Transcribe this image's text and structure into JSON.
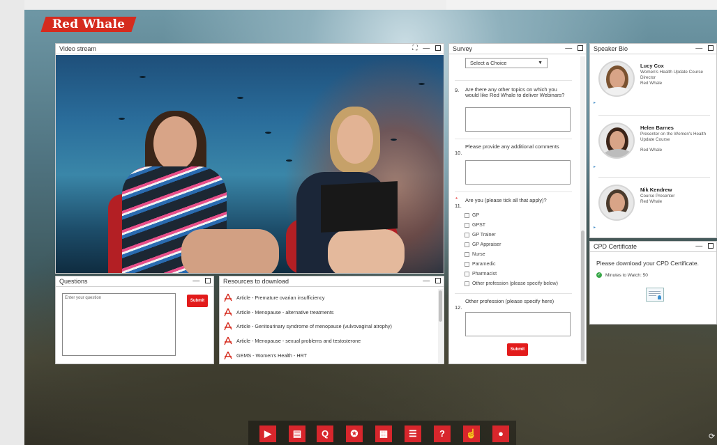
{
  "brand": {
    "logo_text": "Red Whale"
  },
  "video": {
    "title": "Video stream",
    "ctrl_expand": "⛶",
    "ctrl_min": "—"
  },
  "questions": {
    "title": "Questions",
    "ctrl_min": "—",
    "placeholder": "Enter your question",
    "submit_label": "Submit"
  },
  "resources": {
    "title": "Resources to download",
    "ctrl_min": "—",
    "items": [
      {
        "label": "Article - Premature ovarian insufficiency"
      },
      {
        "label": "Article - Menopause - alternative treatments"
      },
      {
        "label": "Article - Genitourinary syndrome of menopause (vulvovaginal atrophy)"
      },
      {
        "label": "Article - Menopause - sexual problems and testosterone"
      },
      {
        "label": "GEMS - Women's Health - HRT"
      }
    ]
  },
  "survey": {
    "title": "Survey",
    "ctrl_min": "—",
    "select_value": "Select a Choice",
    "select_arrow": "▼",
    "q9": {
      "num": "9.",
      "text": "Are there any other topics on which you would like Red Whale to deliver Webinars?"
    },
    "q10": {
      "num": "10.",
      "text": "Please provide any additional comments"
    },
    "q11": {
      "req": "*",
      "num": "11.",
      "text": "Are you (please tick all that apply)?"
    },
    "options": [
      {
        "label": "GP"
      },
      {
        "label": "GPST"
      },
      {
        "label": "GP Trainer"
      },
      {
        "label": "GP Appraiser"
      },
      {
        "label": "Nurse"
      },
      {
        "label": "Paramedic"
      },
      {
        "label": "Pharmacist"
      },
      {
        "label": "Other profession (please specify below)"
      }
    ],
    "q12": {
      "num": "12.",
      "text": "Other profession (please specify here)"
    },
    "submit_label": "Submit"
  },
  "speakers": {
    "title": "Speaker Bio",
    "ctrl_min": "—",
    "list": [
      {
        "name": "Lucy Cox",
        "role": "Women's Health Update Course Director",
        "org": "Red Whale",
        "arrow": "▸"
      },
      {
        "name": "Helen Barnes",
        "role": "Presenter on the Women's Health Update Course",
        "org": "Red Whale",
        "arrow": "▸"
      },
      {
        "name": "Nik Kendrew",
        "role": "Course Presenter",
        "org": "Red Whale",
        "arrow": "▸"
      }
    ]
  },
  "cpd": {
    "title": "CPD Certificate",
    "ctrl_min": "—",
    "message": "Please download your CPD Certificate.",
    "watch": "Minutes to Watch: 50",
    "check": "✓"
  },
  "toolbar": {
    "play": "▶",
    "docs": "▤",
    "questions": "Q",
    "award": "✪",
    "calendar": "▦",
    "list": "☰",
    "help": "?",
    "touch": "☝",
    "user": "●"
  },
  "corner_icon": "⟳"
}
